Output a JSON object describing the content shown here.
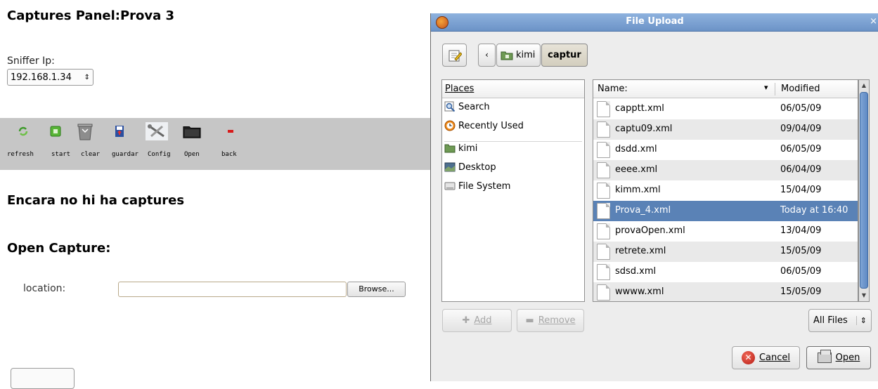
{
  "page": {
    "title": "Captures Panel:Prova 3",
    "sniffer_label": "Sniffer Ip:",
    "sniffer_ip": "192.168.1.34",
    "toolbar": [
      {
        "label": "refresh",
        "icon": "refresh-icon"
      },
      {
        "label": "start",
        "icon": "play-icon"
      },
      {
        "label": "clear",
        "icon": "trash-icon"
      },
      {
        "label": "guardar",
        "icon": "save-icon"
      },
      {
        "label": "Config",
        "icon": "wrench-icon"
      },
      {
        "label": "Open",
        "icon": "folder-icon"
      },
      {
        "label": "back",
        "icon": "minus-icon"
      }
    ],
    "no_captures": "Encara no hi ha captures",
    "open_capture": "Open Capture:",
    "location_label": "location:",
    "location_value": "",
    "browse_label": "Browse..."
  },
  "dialog": {
    "title": "File Upload",
    "breadcrumb": [
      "kimi",
      "captur"
    ],
    "places_header": "Places",
    "places": [
      {
        "label": "Search",
        "icon": "search-icon"
      },
      {
        "label": "Recently Used",
        "icon": "recent-icon"
      },
      {
        "label": "kimi",
        "icon": "home-folder-icon"
      },
      {
        "label": "Desktop",
        "icon": "desktop-icon"
      },
      {
        "label": "File System",
        "icon": "drive-icon"
      }
    ],
    "columns": {
      "name": "Name:",
      "modified": "Modified"
    },
    "files": [
      {
        "name": "capptt.xml",
        "modified": "06/05/09"
      },
      {
        "name": "captu09.xml",
        "modified": "09/04/09"
      },
      {
        "name": "dsdd.xml",
        "modified": "06/05/09"
      },
      {
        "name": "eeee.xml",
        "modified": "06/04/09"
      },
      {
        "name": "kimm.xml",
        "modified": "15/04/09"
      },
      {
        "name": "Prova_4.xml",
        "modified": "Today at 16:40"
      },
      {
        "name": "provaOpen.xml",
        "modified": "13/04/09"
      },
      {
        "name": "retrete.xml",
        "modified": "15/05/09"
      },
      {
        "name": "sdsd.xml",
        "modified": "06/05/09"
      },
      {
        "name": "wwww.xml",
        "modified": "15/05/09"
      }
    ],
    "selected_file": "Prova_4.xml",
    "add_label": "Add",
    "remove_label": "Remove",
    "filter": "All Files",
    "cancel_label": "Cancel",
    "open_label": "Open",
    "accent_color": "#5a82b6"
  }
}
